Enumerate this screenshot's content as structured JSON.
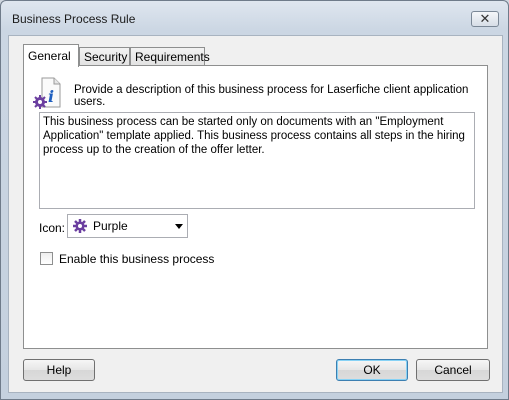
{
  "window": {
    "title": "Business Process Rule",
    "close_glyph": "✕"
  },
  "tabs": [
    {
      "label": "General"
    },
    {
      "label": "Security"
    },
    {
      "label": "Requirements"
    }
  ],
  "general": {
    "description_prompt": "Provide a description of this business process for Laserfiche client application users.",
    "description_value": "This business process can be started only on documents with an \"Employment Application\" template applied. This business process contains all steps in the hiring process up to the creation of the offer letter.",
    "icon_label": "Icon:",
    "icon_selected": "Purple",
    "enable_label": "Enable this business process",
    "enable_checked": false
  },
  "buttons": {
    "help": "Help",
    "ok": "OK",
    "cancel": "Cancel"
  },
  "colors": {
    "accent_purple": "#6b3fa0",
    "info_blue": "#1f5fbf"
  }
}
